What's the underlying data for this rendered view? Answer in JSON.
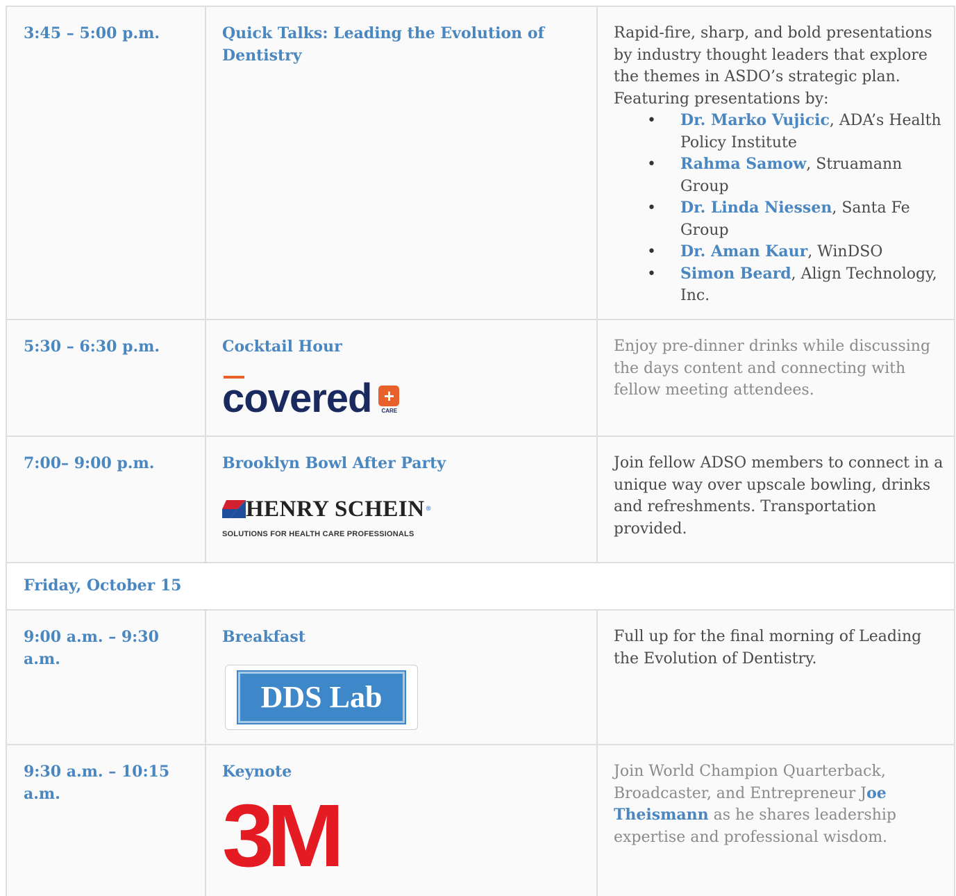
{
  "rows": [
    {
      "time": "3:45 – 5:00 p.m.",
      "title": "Quick Talks: Leading the Evolution of Dentistry",
      "desc_intro": "Rapid-fire, sharp, and bold presentations by industry thought leaders that explore the themes in ASDO’s strategic plan. Featuring presentations by:",
      "speakers": [
        {
          "name": "Dr. Marko Vujicic",
          "org": ", ADA’s Health Policy Institute"
        },
        {
          "name": "Rahma Samow",
          "org": ", Struamann Group"
        },
        {
          "name": "Dr. Linda Niessen",
          "org": ", Santa Fe Group"
        },
        {
          "name": "Dr. Aman Kaur",
          "org": ", WinDSO"
        },
        {
          "name": "Simon Beard",
          "org": ", Align Technology, Inc."
        }
      ]
    },
    {
      "time": "5:30 – 6:30 p.m.",
      "title": "Cocktail Hour",
      "sponsor": {
        "word": "covered",
        "plus": "+",
        "care": "CARE"
      },
      "desc": "Enjoy pre-dinner drinks while discussing the days content and connecting with fellow meeting attendees."
    },
    {
      "time": "7:00– 9:00 p.m.",
      "title": "Brooklyn Bowl After Party",
      "sponsor": {
        "name": "HENRY SCHEIN",
        "reg": "®",
        "tagline": "SOLUTIONS FOR HEALTH CARE PROFESSIONALS"
      },
      "desc": "Join fellow ADSO members to connect in a unique way over upscale bowling, drinks and refreshments. Transportation provided."
    },
    {
      "day": "Friday, October 15"
    },
    {
      "time": "9:00 a.m. – 9:30 a.m.",
      "title": "Breakfast",
      "sponsor": {
        "name": "DDS Lab"
      },
      "desc": "Full up for the final morning of Leading the Evolution of Dentistry."
    },
    {
      "time": "9:30 a.m. – 10:15 a.m.",
      "title": "Keynote",
      "sponsor": {
        "name": "3M"
      },
      "desc_pre": "Join World Champion Quarterback, Broadcaster, and Entrepreneur J",
      "desc_name": "oe Theismann",
      "desc_post": " as he shares leadership expertise and professional wisdom."
    }
  ],
  "colors": {
    "accent": "#4a87c0",
    "border": "#dedede",
    "logo_3m": "#e41b23",
    "covered_orange": "#e8612d",
    "covered_navy": "#1a2a5e",
    "dds_blue": "#3e87c8"
  }
}
